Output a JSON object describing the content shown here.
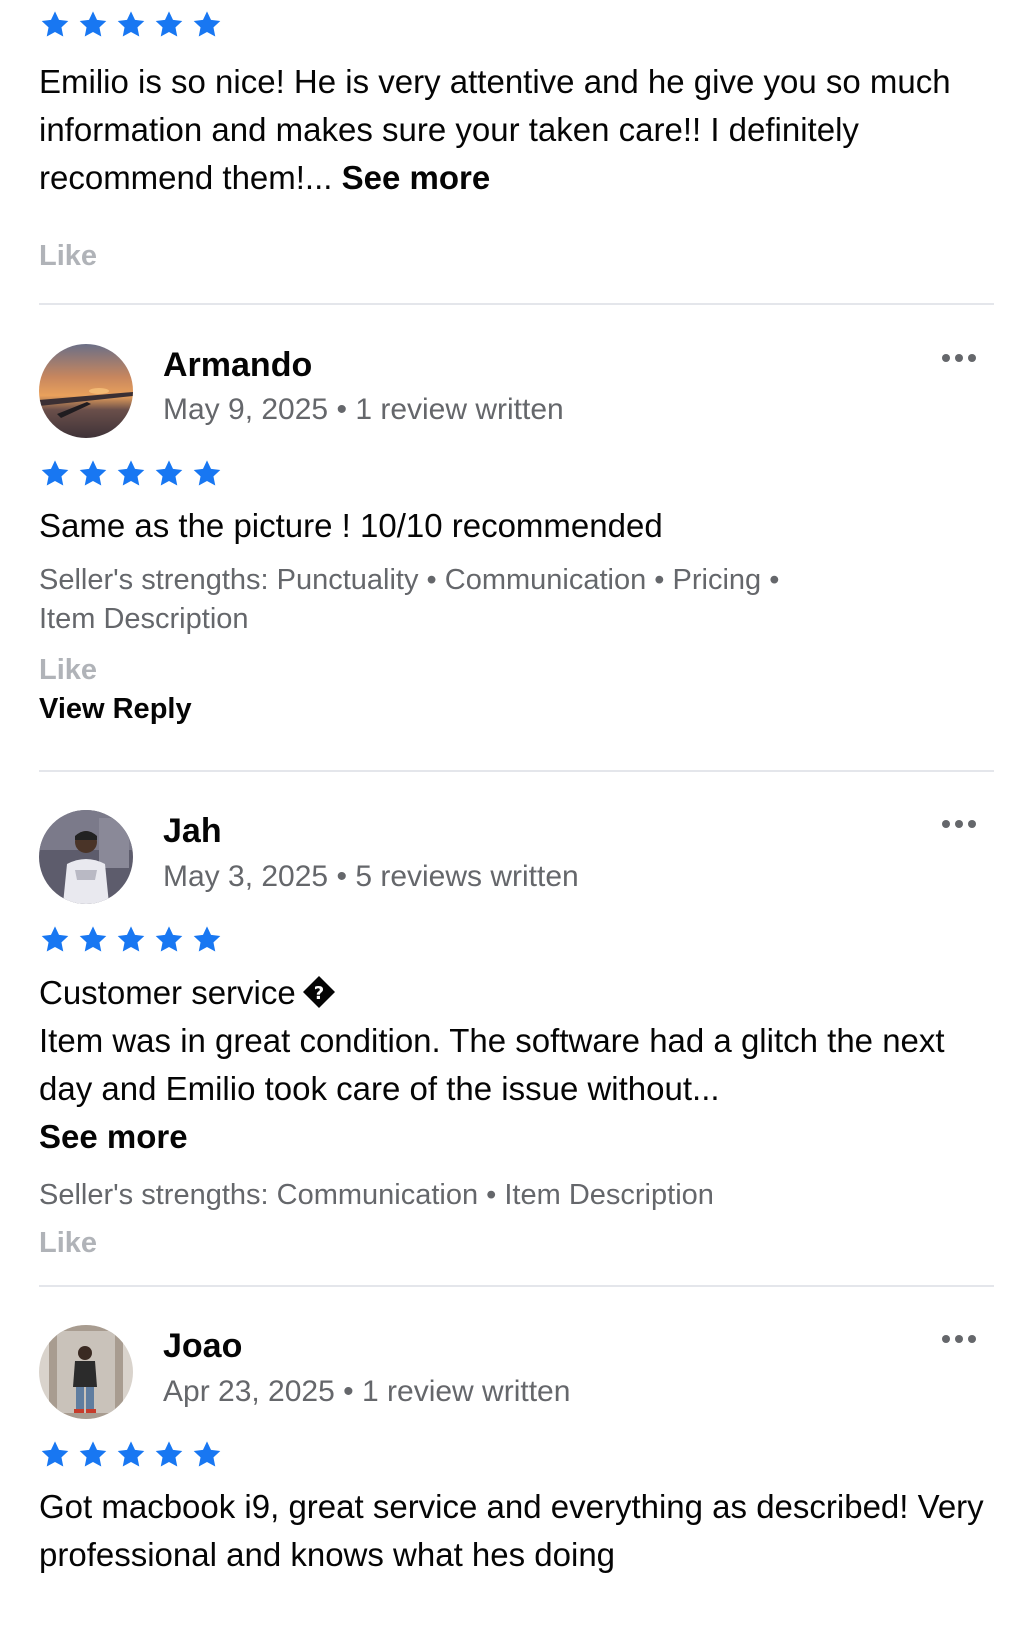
{
  "colors": {
    "star": "#1877f2",
    "muted": "#65676b",
    "like": "#b0b3b8",
    "divider": "#e4e6eb"
  },
  "top_review": {
    "rating": 5,
    "text": "Emilio is so nice! He is very attentive and he give you so much information and makes sure your taken care!! I definitely recommend them!...",
    "see_more": "See more",
    "like": "Like"
  },
  "reviews": [
    {
      "name": "Armando",
      "date": "May 9, 2025",
      "separator": "•",
      "count": "1 review written",
      "rating": 5,
      "text": "Same as the picture ! 10/10 recommended",
      "strengths_1": "Seller's strengths: Punctuality • Communication • Pricing •",
      "strengths_2": "Item Description",
      "like": "Like",
      "view_reply": "View Reply",
      "avatar_icon": "sunset-plane-window-avatar",
      "more_icon": "more-options-icon"
    },
    {
      "name": "Jah",
      "date": "May 3, 2025",
      "separator": "•",
      "count": "5 reviews written",
      "rating": 5,
      "text_1": "Customer service",
      "text_2": "Item was in great condition. The software had a glitch the next day and Emilio took care of the issue without...",
      "see_more": "See more",
      "strengths_1": "Seller's strengths: Communication • Item Description",
      "like": "Like",
      "avatar_icon": "person-avatar",
      "more_icon": "more-options-icon"
    },
    {
      "name": "Joao",
      "date": "Apr 23, 2025",
      "separator": "•",
      "count": "1 review written",
      "rating": 5,
      "text": "Got macbook i9, great service and everything as described! Very professional and knows what hes doing",
      "avatar_icon": "person-mirror-avatar",
      "more_icon": "more-options-icon"
    }
  ]
}
